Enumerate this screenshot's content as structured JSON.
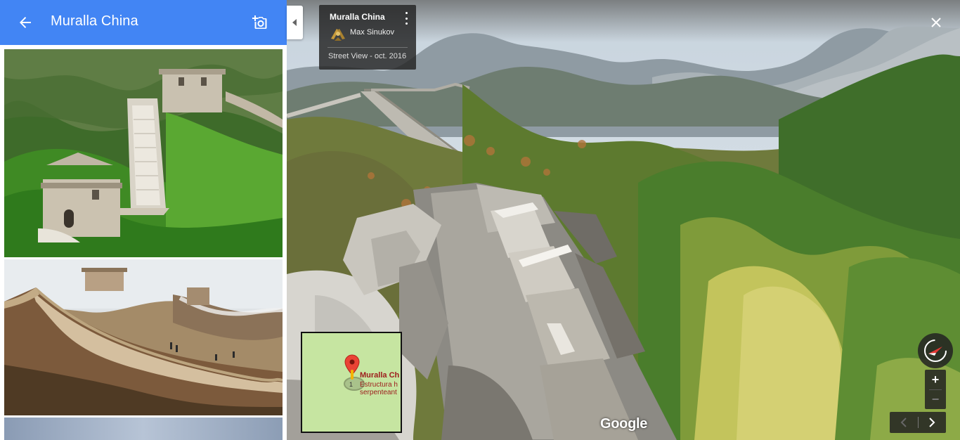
{
  "panel": {
    "title": "Muralla China",
    "back_icon": "arrow-back-icon",
    "add_photo_icon": "add-photo-camera-icon",
    "photos": [
      {
        "label": "photo-great-wall-1"
      },
      {
        "label": "photo-great-wall-2"
      },
      {
        "label": "photo-great-wall-3"
      }
    ]
  },
  "info_card": {
    "title": "Muralla China",
    "author": "Max Sinukov",
    "date": "Street View - oct. 2016",
    "menu_icon": "more-vert-icon"
  },
  "minimap": {
    "place_name": "Muralla Ch",
    "desc_line1": "Estructura h",
    "desc_line2": "serpenteant",
    "marker_number": "1"
  },
  "logo": "Google",
  "controls": {
    "zoom_in": "+",
    "zoom_out": "−",
    "close_icon": "close-icon",
    "compass_icon": "compass-icon",
    "prev_icon": "chevron-left-icon",
    "next_icon": "chevron-right-icon"
  },
  "colors": {
    "header_blue": "#4285f4",
    "overlay_dark": "#222222",
    "minimap_green": "#c6e5a1",
    "marker_red": "#ea4335"
  }
}
